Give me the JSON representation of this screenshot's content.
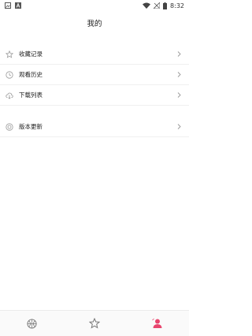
{
  "status_bar": {
    "time": "8:32"
  },
  "header": {
    "title": "我的"
  },
  "menu": {
    "items": [
      {
        "label": "收藏记录",
        "icon": "star-icon"
      },
      {
        "label": "观看历史",
        "icon": "clock-icon"
      },
      {
        "label": "下载列表",
        "icon": "cloud-download-icon"
      }
    ],
    "settings": [
      {
        "label": "版本更新",
        "icon": "update-icon"
      }
    ]
  },
  "bottom_nav": {
    "tabs": [
      {
        "icon": "basketball-icon",
        "active": false
      },
      {
        "icon": "star-icon",
        "active": false
      },
      {
        "icon": "profile-icon",
        "active": true
      }
    ],
    "active_color": "#e8466e"
  }
}
